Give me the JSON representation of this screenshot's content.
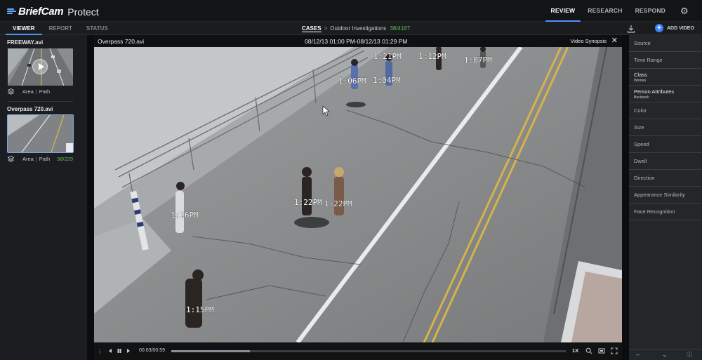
{
  "app": {
    "brand": "BriefCam",
    "product": "Protect"
  },
  "topnav": {
    "review": "REVIEW",
    "research": "RESEARCH",
    "respond": "RESPOND"
  },
  "tabs": {
    "viewer": "VIEWER",
    "report": "REPORT",
    "status": "STATUS"
  },
  "breadcrumb": {
    "cases": "CASES",
    "separator": ">",
    "case_name": "Outdoor Investigations",
    "count": "38/4167"
  },
  "add_video_label": "ADD VIDEO",
  "clips": [
    {
      "title": "FREEWAY.avi",
      "area": "Area",
      "path": "Path",
      "count": ""
    },
    {
      "title": "Overpass 720.avi",
      "area": "Area",
      "path": "Path",
      "count": "38/229"
    }
  ],
  "viewer": {
    "file": "Overpass 720.avi",
    "range": "08/12/13 01:00 PM-08/12/13 01:29 PM",
    "mode": "Video Synopsis",
    "close": "✕",
    "timestamps": [
      "1:21PM",
      "1:12PM",
      "1:07PM",
      "1:06PM",
      "1:04PM",
      "1:22PM",
      "1:22PM",
      "1:26PM",
      "1:15PM"
    ]
  },
  "controls": {
    "time": "00:03/00:59",
    "speed": "1X",
    "progress": 0.2
  },
  "filters": [
    {
      "label": "Source",
      "value": ""
    },
    {
      "label": "Time Range",
      "value": ""
    },
    {
      "label": "Class",
      "value": "Woman"
    },
    {
      "label": "Person Attributes",
      "value": "Backpack"
    },
    {
      "label": "Color",
      "value": ""
    },
    {
      "label": "Size",
      "value": ""
    },
    {
      "label": "Speed",
      "value": ""
    },
    {
      "label": "Dwell",
      "value": ""
    },
    {
      "label": "Direction",
      "value": ""
    },
    {
      "label": "Appearance Similarity",
      "value": ""
    },
    {
      "label": "Face Recognition",
      "value": ""
    }
  ],
  "colors": {
    "accent": "#4e94ff",
    "count_green": "#5dc05a",
    "panel": "#24272a"
  }
}
